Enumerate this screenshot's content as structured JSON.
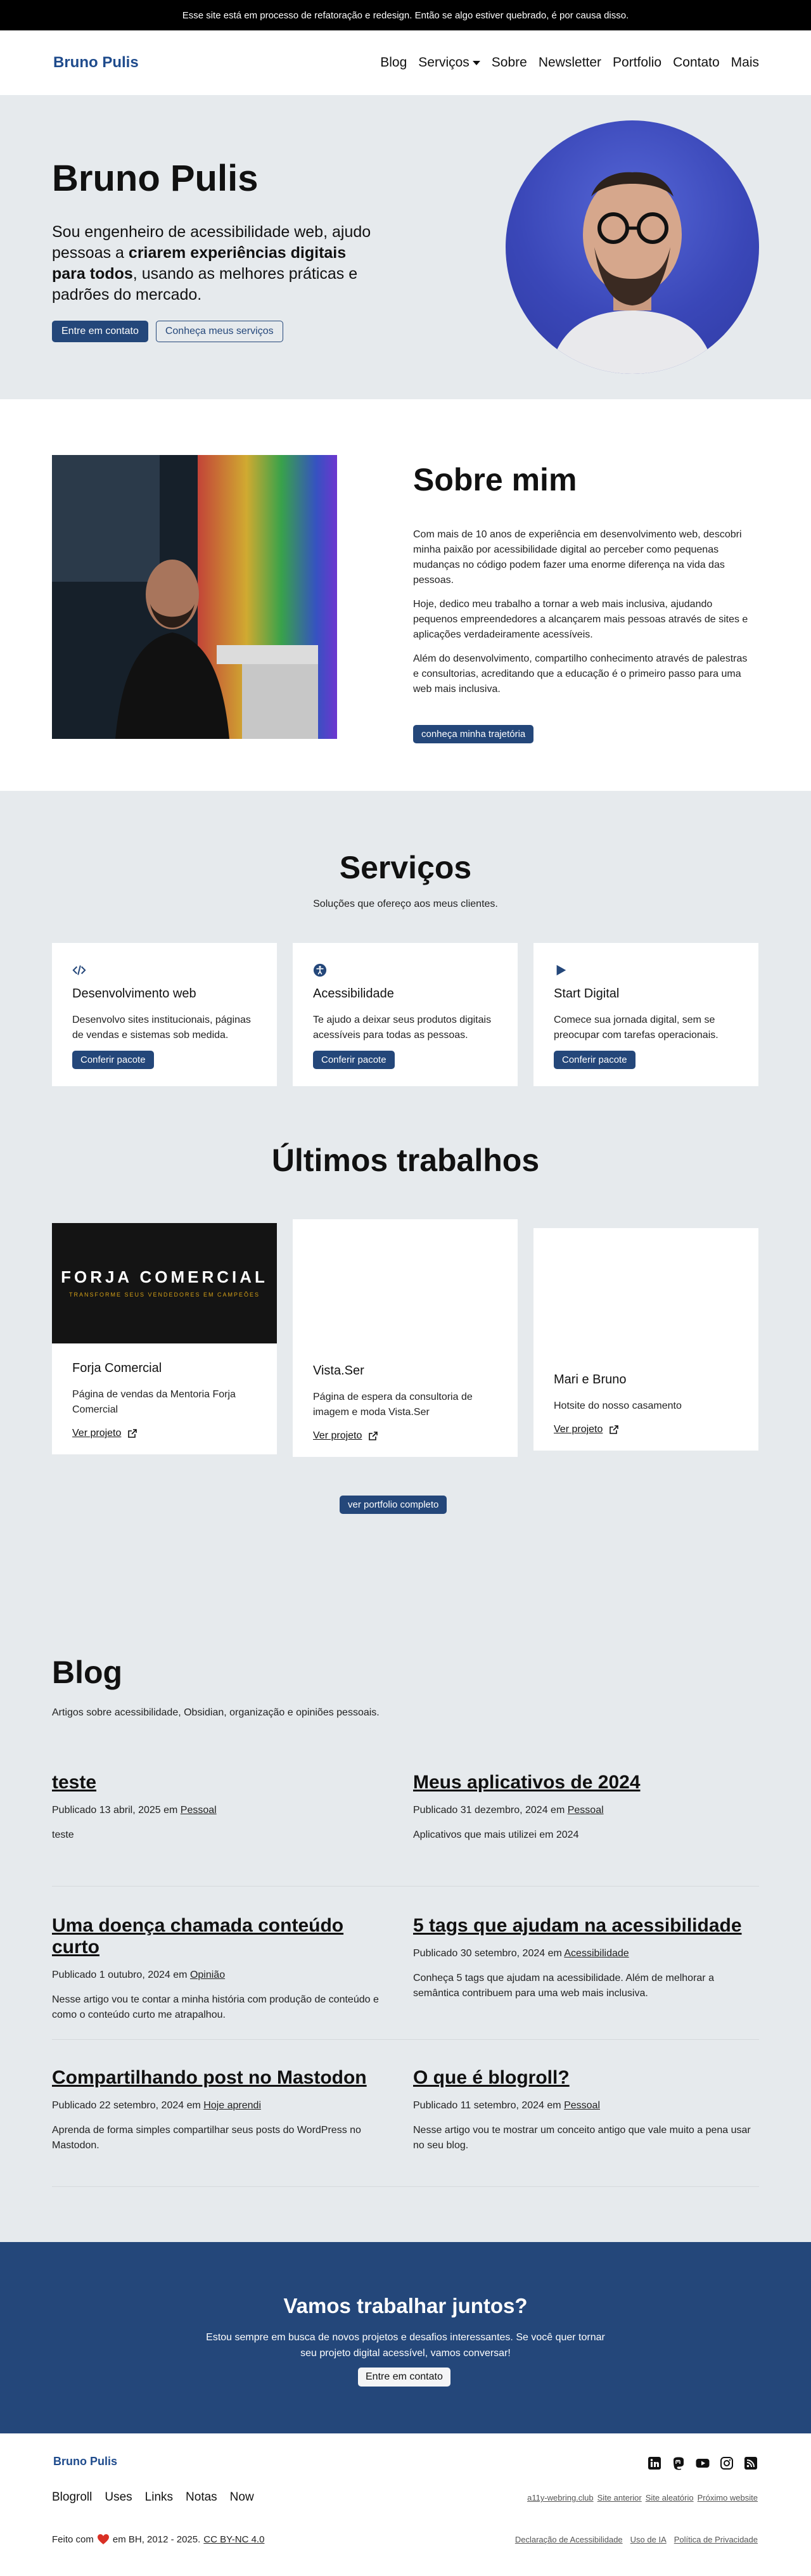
{
  "notice": "Esse site está em processo de refatoração e redesign. Então se algo estiver quebrado, é por causa disso.",
  "header": {
    "brand": "Bruno Pulis",
    "nav": [
      "Blog",
      "Serviços",
      "Sobre",
      "Newsletter",
      "Portfolio",
      "Contato",
      "Mais"
    ]
  },
  "hero": {
    "title": "Bruno Pulis",
    "intro_a": "Sou engenheiro de acessibilidade web, ajudo pessoas a ",
    "intro_bold": "criarem experiências digitais para todos",
    "intro_b": ", usando as melhores práticas e padrões do mercado.",
    "cta_primary": "Entre em contato",
    "cta_secondary": "Conheça meus serviços"
  },
  "about": {
    "title": "Sobre mim",
    "paragraphs": [
      "Com mais de 10 anos de experiência em desenvolvimento web, descobri minha paixão por acessibilidade digital ao perceber como pequenas mudanças no código podem fazer uma enorme diferença na vida das pessoas.",
      "Hoje, dedico meu trabalho a tornar a web mais inclusiva, ajudando pequenos empreendedores a alcançarem mais pessoas através de sites e aplicações verdadeiramente acessíveis.",
      "Além do desenvolvimento, compartilho conhecimento através de palestras e consultorias, acreditando que a educação é o primeiro passo para uma web mais inclusiva."
    ],
    "button": "conheça minha trajetória"
  },
  "services": {
    "title": "Serviços",
    "subtitle": "Soluções que ofereço aos meus clientes.",
    "items": [
      {
        "icon": "code-icon",
        "title": "Desenvolvimento web",
        "text": "Desenvolvo sites institucionais, páginas de vendas e sistemas sob medida.",
        "button": "Conferir pacote"
      },
      {
        "icon": "accessibility-icon",
        "title": "Acessibilidade",
        "text": "Te ajudo a deixar seus produtos digitais acessíveis para todas as pessoas.",
        "button": "Conferir pacote"
      },
      {
        "icon": "play-icon",
        "title": "Start Digital",
        "text": "Comece sua jornada digital, sem se preocupar com tarefas operacionais.",
        "button": "Conferir pacote"
      }
    ]
  },
  "works": {
    "title": "Últimos trabalhos",
    "items": [
      {
        "title": "Forja Comercial",
        "text": "Página de vendas da Mentoria Forja Comercial",
        "link": "Ver projeto",
        "thumb_title": "FORJA COMERCIAL",
        "thumb_sub": "TRANSFORME SEUS VENDEDORES EM CAMPEÕES"
      },
      {
        "title": "Vista.Ser",
        "text": "Página de espera da consultoria de imagem e moda Vista.Ser",
        "link": "Ver projeto"
      },
      {
        "title": "Mari e Bruno",
        "text": "Hotsite do nosso casamento",
        "link": "Ver projeto"
      }
    ],
    "button": "ver portfolio completo"
  },
  "blog": {
    "title": "Blog",
    "intro": "Artigos sobre acessibilidade, Obsidian, organização e opiniões pessoais.",
    "posts": [
      {
        "title": "teste",
        "meta_a": "Publicado 13 abril, 2025 em ",
        "category": "Pessoal",
        "excerpt": "teste"
      },
      {
        "title": "Meus aplicativos de 2024",
        "meta_a": "Publicado 31 dezembro, 2024 em ",
        "category": "Pessoal",
        "excerpt": "Aplicativos que mais utilizei em 2024"
      },
      {
        "title": "Uma doença chamada conteúdo curto",
        "meta_a": "Publicado 1 outubro, 2024 em ",
        "category": "Opinião",
        "excerpt": "Nesse artigo vou te contar a minha história com produção de conteúdo e como o conteúdo curto me atrapalhou."
      },
      {
        "title": "5 tags que ajudam na acessibilidade",
        "meta_a": "Publicado 30 setembro, 2024 em ",
        "category": "Acessibilidade",
        "excerpt": "Conheça 5 tags que ajudam na acessibilidade. Além de melhorar a semântica contribuem para uma web mais inclusiva."
      },
      {
        "title": "Compartilhando post no Mastodon",
        "meta_a": "Publicado 22 setembro, 2024 em ",
        "category": "Hoje aprendi",
        "excerpt": "Aprenda de forma simples compartilhar seus posts do WordPress no Mastodon."
      },
      {
        "title": "O que é blogroll?",
        "meta_a": "Publicado 11 setembro, 2024 em ",
        "category": "Pessoal",
        "excerpt": "Nesse artigo vou te mostrar um conceito antigo que vale muito a pena usar no seu blog."
      }
    ]
  },
  "cta": {
    "title": "Vamos trabalhar juntos?",
    "text": "Estou sempre em busca de novos projetos e desafios interessantes. Se você quer tornar seu projeto digital acessível, vamos conversar!",
    "button": "Entre em contato"
  },
  "footer": {
    "brand": "Bruno Pulis",
    "social_icons": [
      "linkedin-icon",
      "mastodon-icon",
      "youtube-icon",
      "instagram-icon",
      "rss-icon"
    ],
    "links": [
      "Blogroll",
      "Uses",
      "Links",
      "Notas",
      "Now"
    ],
    "webring": [
      "a11y-webring.club",
      "Site anterior",
      "Site aleatório",
      "Próximo website"
    ],
    "made_a": "Feito com",
    "made_b": "em BH, 2012 - 2025.",
    "license": "CC BY-NC 4.0",
    "legal": [
      "Declaração de Acessibilidade",
      "Uso de IA",
      "Política de Privacidade"
    ]
  }
}
